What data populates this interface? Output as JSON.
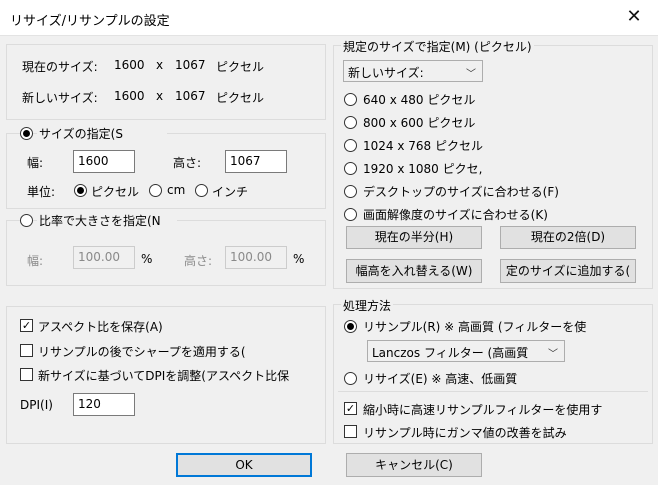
{
  "window": {
    "title": "リサイズ/リサンプルの設定",
    "close_glyph": "✕"
  },
  "current_size": {
    "label": "現在のサイズ:",
    "width": "1600",
    "x": "x",
    "height": "1067",
    "unit": "ピクセル"
  },
  "new_size": {
    "label": "新しいサイズ:",
    "width": "1600",
    "x": "x",
    "height": "1067",
    "unit": "ピクセル"
  },
  "specify_size": {
    "label": "サイズの指定(S",
    "selected": true,
    "width_label": "幅:",
    "width_value": "1600",
    "height_label": "高さ:",
    "height_value": "1067",
    "unit_label": "単位:",
    "units": [
      {
        "label": "ピクセル",
        "selected": true
      },
      {
        "label": "cm",
        "selected": false
      },
      {
        "label": "インチ",
        "selected": false
      }
    ]
  },
  "specify_ratio": {
    "label": "比率で大きさを指定(N",
    "selected": false,
    "width_label": "幅:",
    "width_value": "100.00",
    "width_unit": "%",
    "height_label": "高さ:",
    "height_value": "100.00",
    "height_unit": "%"
  },
  "options": {
    "keep_aspect": {
      "label": "アスペクト比を保存(A)",
      "checked": true
    },
    "sharpen": {
      "label": "リサンプルの後でシャープを適用する(",
      "checked": false
    },
    "dpi_adjust": {
      "label": "新サイズに基づいてDPIを調整(アスペクト比保",
      "checked": false
    },
    "dpi_label": "DPI(I)",
    "dpi_value": "120"
  },
  "preset": {
    "legend": "規定のサイズで指定(M) (ピクセル)",
    "dropdown_value": "新しいサイズ:",
    "items": [
      {
        "label": "640 x 480 ピクセル",
        "selected": false
      },
      {
        "label": "800 x 600 ピクセル",
        "selected": false
      },
      {
        "label": "1024 x 768 ピクセル",
        "selected": false
      },
      {
        "label": "1920 x 1080 ピクセ,",
        "selected": false
      },
      {
        "label": "デスクトップのサイズに合わせる(F)",
        "selected": false
      },
      {
        "label": "画面解像度のサイズに合わせる(K)",
        "selected": false
      }
    ],
    "half_button": "現在の半分(H)",
    "double_button": "現在の2倍(D)",
    "swap_button": "幅高を入れ替える(W)",
    "add_button": "定のサイズに追加する("
  },
  "method": {
    "legend": "処理方法",
    "resample": {
      "label": "リサンプル(R) ※ 高画質 (フィルターを使",
      "selected": true
    },
    "filter_value": "Lanczos フィルター (高画質",
    "resize": {
      "label": "リサイズ(E) ※ 高速、低画質",
      "selected": false
    },
    "fast_filter": {
      "label": "縮小時に高速リサンプルフィルターを使用す",
      "checked": true
    },
    "gamma": {
      "label": "リサンプル時にガンマ値の改善を試み",
      "checked": false
    }
  },
  "buttons": {
    "ok": "OK",
    "cancel": "キャンセル(C)"
  }
}
